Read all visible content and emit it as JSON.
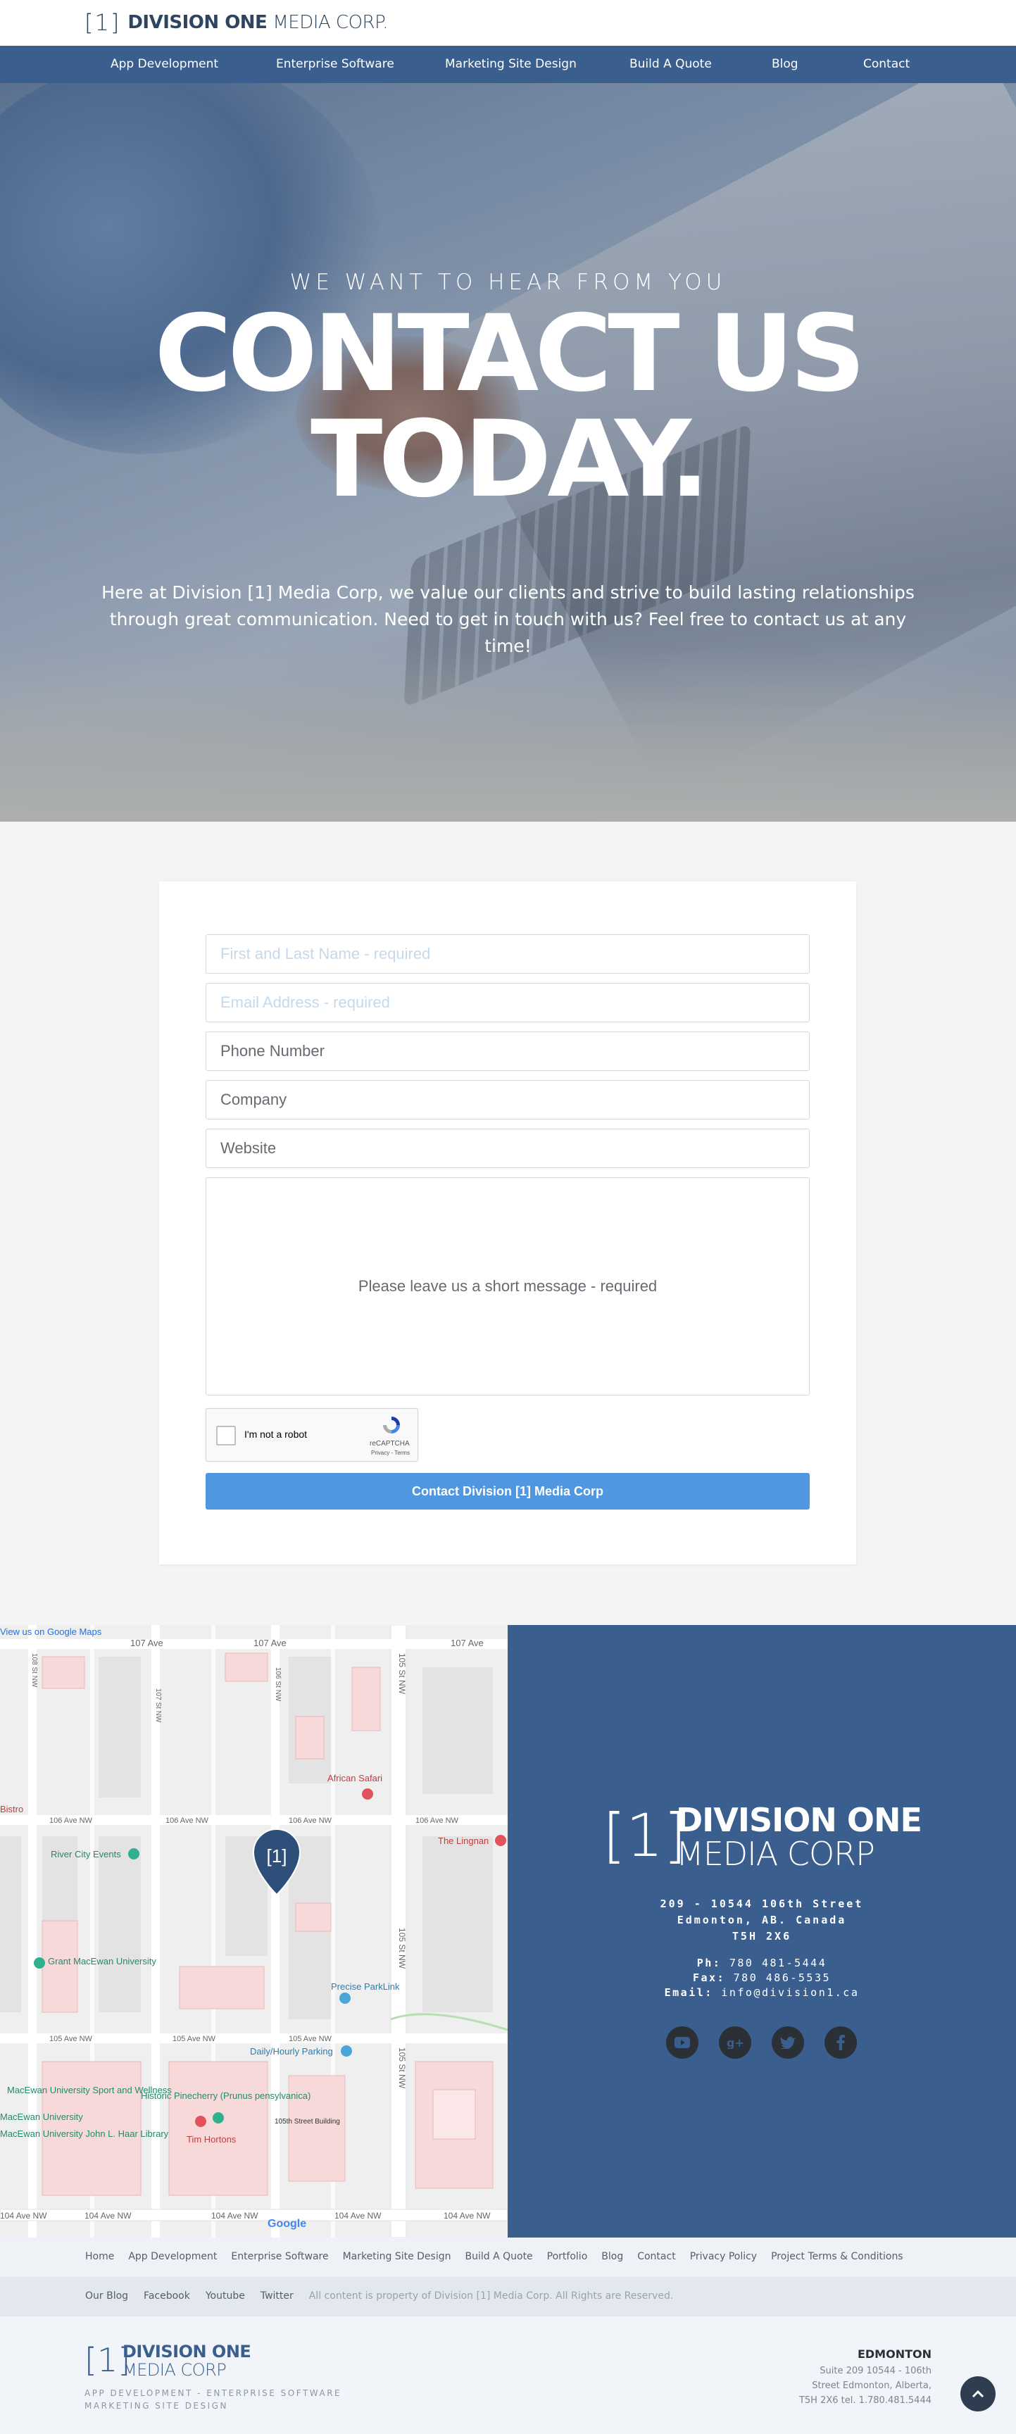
{
  "brand": {
    "bracket": "[1]",
    "name_bold": "DIVISION ONE",
    "name_light": "MEDIA CORP."
  },
  "nav": {
    "items": [
      "App Development",
      "Enterprise Software",
      "Marketing Site Design",
      "Build A Quote",
      "Blog",
      "Contact"
    ]
  },
  "hero": {
    "kicker": "WE WANT TO HEAR FROM YOU",
    "title_line1": "CONTACT US",
    "title_line2": "TODAY.",
    "text": "Here at Division [1] Media Corp, we value our clients and strive to build lasting relationships through great communication. Need to get in touch with us? Feel free to contact us at any time!"
  },
  "form": {
    "name_placeholder": "First and Last Name - required",
    "email_placeholder": "Email Address - required",
    "phone_placeholder": "Phone Number",
    "company_placeholder": "Company",
    "website_placeholder": "Website",
    "message_placeholder": "Please leave us a short message - required",
    "captcha_label": "I'm not a robot",
    "captcha_brand": "reCAPTCHA",
    "captcha_terms": "Privacy - Terms",
    "submit_label": "Contact Division [1] Media Corp"
  },
  "map": {
    "view_label": "View us on Google Maps",
    "google": "Google",
    "streets": {
      "ave107": "107 Ave",
      "ave106": "106 Ave NW",
      "ave105": "105 Ave NW",
      "ave104": "104 Ave NW",
      "st108": "108 St NW",
      "st107": "107 St NW",
      "st106": "106 St NW",
      "st105": "105 St NW"
    },
    "places": {
      "african_safari": "African Safari",
      "lingnan": "The Lingnan",
      "river_city": "River City Events",
      "grant_macewan": "Grant MacEwan University",
      "precise_parklink": "Precise ParkLink",
      "daily_parking": "Daily/Hourly Parking",
      "macewan_sport": "MacEwan University Sport and Wellness",
      "macewan_univ": "MacEwan University",
      "macewan_library": "MacEwan University John L. Haar Library",
      "pinecherry": "Historic Pinecherry (Prunus pensylvanica)",
      "tim_hortons": "Tim Hortons",
      "street_building": "105th Street Building",
      "bistro": "Bistro"
    },
    "marker_label": "[1]"
  },
  "contact": {
    "logo_bracket": "[1]",
    "logo_bold": "DIVISION ONE",
    "logo_light": "MEDIA CORP",
    "address_line1": "209 - 10544 106th Street",
    "address_line2": "Edmonton, AB. Canada",
    "address_line3": "T5H 2X6",
    "phone_label": "Ph:",
    "phone": "780 481-5444",
    "fax_label": "Fax:",
    "fax": "780 486-5535",
    "email_label": "Email:",
    "email": "info@division1.ca",
    "social": [
      "YouTube",
      "Google+",
      "Twitter",
      "Facebook"
    ]
  },
  "footer": {
    "links": [
      "Home",
      "App Development",
      "Enterprise Software",
      "Marketing Site Design",
      "Build A Quote",
      "Portfolio",
      "Blog",
      "Contact",
      "Privacy Policy",
      "Project Terms & Conditions"
    ],
    "social_links": [
      "Our Blog",
      "Facebook",
      "Youtube",
      "Twitter"
    ],
    "copyright": "All content is property of Division [1] Media Corp. All Rights are Reserved.",
    "logo_bracket": "[1]",
    "logo_bold": "DIVISION ONE",
    "logo_light": "MEDIA CORP",
    "tagline_line1": "APP DEVELOPMENT - ENTERPRISE SOFTWARE",
    "tagline_line2": "MARKETING SITE DESIGN",
    "office_city": "EDMONTON",
    "office_line1": "Suite 209 10544 - 106th",
    "office_line2": "Street Edmonton, Alberta,",
    "office_line3": "T5H 2X6 tel. 1.780.481.5444",
    "to_top_icon": "chevron-up-icon"
  },
  "colors": {
    "nav_bg": "#3a5f8e",
    "submit_bg": "#4f97e0",
    "brand_text": "#2d4560"
  }
}
